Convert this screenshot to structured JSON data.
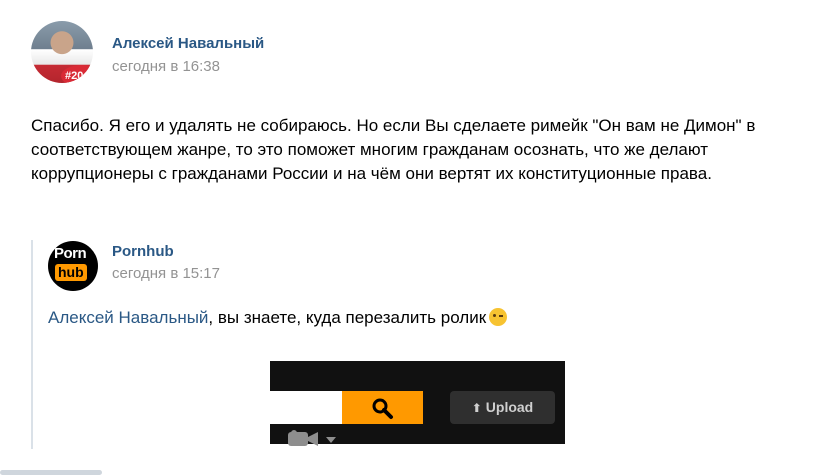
{
  "post": {
    "author": "Алексей Навальный",
    "time": "сегодня в 16:38",
    "avatar_badge": "#20",
    "text": "Спасибо. Я его и удалять не собираюсь. Но если Вы сделаете римейк \"Он вам не Димон\" в соответствующем жанре, то это поможет многим гражданам осознать, что же делают коррупционеры с гражданами России и на чём они вертят их конституционные права."
  },
  "quoted": {
    "author": "Pornhub",
    "time": "сегодня в 15:17",
    "avatar_top": "Porn",
    "avatar_bottom": "hub",
    "mention": "Алексей Навальный",
    "text": ", вы знаете, куда перезалить ролик",
    "emoji": "winking-face",
    "screenshot": {
      "upload_label": "Upload",
      "icons": [
        "camera-icon",
        "chevron-down-icon",
        "search-icon",
        "upload-arrow-icon"
      ]
    }
  },
  "colors": {
    "link": "#2a5885",
    "meta": "#939393",
    "quote_bar": "#dae1e8",
    "brand_orange": "#ff9900"
  }
}
